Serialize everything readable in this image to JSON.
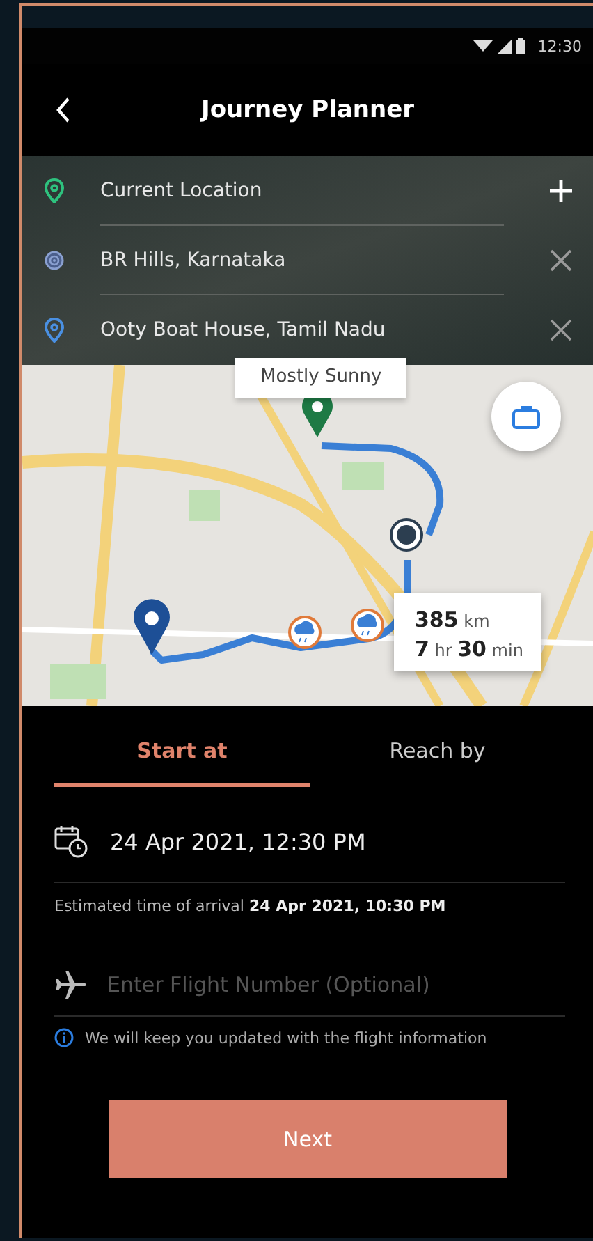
{
  "status_bar": {
    "time": "12:30"
  },
  "header": {
    "title": "Journey Planner"
  },
  "stops": [
    {
      "kind": "origin",
      "name": "Current Location"
    },
    {
      "kind": "waypoint",
      "name": "BR Hills, Karnataka"
    },
    {
      "kind": "destination",
      "name": "Ooty Boat House, Tamil Nadu"
    }
  ],
  "map": {
    "weather": "Mostly Sunny",
    "distance": "**385** km",
    "duration": "**7** hr **30** min"
  },
  "tabs": [
    {
      "label": "Start at",
      "selected": true
    },
    {
      "label": "Reach by",
      "selected": false
    }
  ],
  "departure": {
    "value": "24 Apr 2021, 12:30 PM"
  },
  "eta": "Estimated time of arrival **24 Apr 2021, 10:30 PM**",
  "flight_field": {
    "placeholder": "Enter Flight Number (Optional)"
  },
  "info": "We will keep you updated with the flight information",
  "next_button": "Next"
}
